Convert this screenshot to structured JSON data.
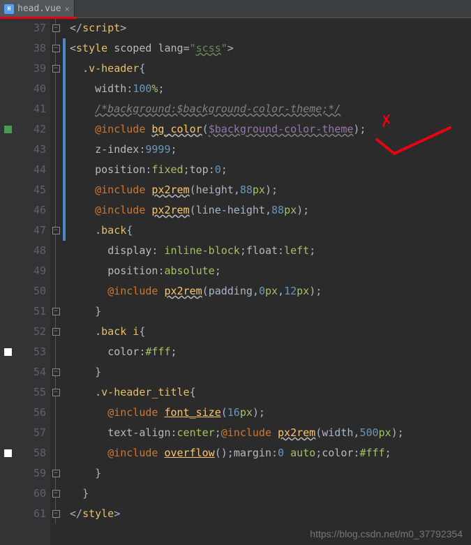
{
  "tab": {
    "icon_letter": "H",
    "filename": "head.vue",
    "close": "×"
  },
  "gutter": {
    "start": 37,
    "end": 61
  },
  "code_lines": [
    {
      "n": 37,
      "html": "<span class='punct'>&lt;/</span><span class='tag'>script</span><span class='punct'>&gt;</span>",
      "fold": "end"
    },
    {
      "n": 38,
      "html": "<span class='punct'>&lt;</span><span class='tag'>style </span><span class='attr'>scoped </span><span class='attr'>lang</span><span class='punct'>=</span><span class='str'>\"</span><span class='str-u'>scss</span><span class='str'>\"</span><span class='punct'>&gt;</span>",
      "fold": "start",
      "change": true
    },
    {
      "n": 39,
      "html": "  <span class='sel'>.v-header</span><span class='punct'>{</span>",
      "fold": "start",
      "change": true
    },
    {
      "n": 40,
      "html": "    <span class='prop'>width</span><span class='punct'>:</span><span class='num'>100</span><span class='val'>%</span><span class='punct'>;</span>",
      "change": true
    },
    {
      "n": 41,
      "html": "    <span class='comment'>/*background:$background-color-theme;*/</span>",
      "change": true
    },
    {
      "n": 42,
      "html": "    <span class='kw'>@include </span><span class='fn'>bg_color</span><span class='punct'>(</span><span class='var'>$background-color-theme</span><span class='punct'>);</span>",
      "mark": "green",
      "change": true
    },
    {
      "n": 43,
      "html": "    <span class='prop'>z-index</span><span class='punct'>:</span><span class='num'>9999</span><span class='punct'>;</span>",
      "change": true
    },
    {
      "n": 44,
      "html": "    <span class='prop'>position</span><span class='punct'>:</span><span class='val'>fixed</span><span class='punct'>;</span><span class='prop'>top</span><span class='punct'>:</span><span class='num'>0</span><span class='punct'>;</span>",
      "change": true
    },
    {
      "n": 45,
      "html": "    <span class='kw'>@include </span><span class='fn'>px2rem</span><span class='punct'>(</span><span class='ident'>height</span><span class='punct'>,</span><span class='num'>88</span><span class='val'>px</span><span class='punct'>);</span>",
      "change": true
    },
    {
      "n": 46,
      "html": "    <span class='kw'>@include </span><span class='fn'>px2rem</span><span class='punct'>(</span><span class='ident'>line-height</span><span class='punct'>,</span><span class='num'>88</span><span class='val'>px</span><span class='punct'>);</span>",
      "change": true
    },
    {
      "n": 47,
      "html": "    <span class='sel'>.back</span><span class='punct'>{</span>",
      "fold": "start",
      "change": true
    },
    {
      "n": 48,
      "html": "      <span class='prop'>display</span><span class='punct'>: </span><span class='val'>inline-block</span><span class='punct'>;</span><span class='prop'>float</span><span class='punct'>:</span><span class='val'>left</span><span class='punct'>;</span>"
    },
    {
      "n": 49,
      "html": "      <span class='prop'>position</span><span class='punct'>:</span><span class='val'>absolute</span><span class='punct'>;</span>"
    },
    {
      "n": 50,
      "html": "      <span class='kw'>@include </span><span class='fn'>px2rem</span><span class='punct'>(</span><span class='ident'>padding</span><span class='punct'>,</span><span class='num'>0</span><span class='val'>px</span><span class='punct'>,</span><span class='num'>12</span><span class='val'>px</span><span class='punct'>);</span>"
    },
    {
      "n": 51,
      "html": "    <span class='punct'>}</span>",
      "fold": "end"
    },
    {
      "n": 52,
      "html": "    <span class='sel'>.back i</span><span class='punct'>{</span>",
      "fold": "start"
    },
    {
      "n": 53,
      "html": "      <span class='prop'>color</span><span class='punct'>:</span><span class='hex'>#fff</span><span class='punct'>;</span>",
      "mark": "white"
    },
    {
      "n": 54,
      "html": "    <span class='punct'>}</span>",
      "fold": "end"
    },
    {
      "n": 55,
      "html": "    <span class='sel'>.v-header_title</span><span class='punct'>{</span>",
      "fold": "start"
    },
    {
      "n": 56,
      "html": "      <span class='kw'>@include </span><span class='fn2'>font_size</span><span class='punct'>(</span><span class='num'>16</span><span class='val'>px</span><span class='punct'>);</span>"
    },
    {
      "n": 57,
      "html": "      <span class='prop'>text-align</span><span class='punct'>:</span><span class='val'>center</span><span class='punct'>;</span><span class='kw'>@include </span><span class='fn'>px2rem</span><span class='punct'>(</span><span class='ident'>width</span><span class='punct'>,</span><span class='num'>500</span><span class='val'>px</span><span class='punct'>);</span>"
    },
    {
      "n": 58,
      "html": "      <span class='kw'>@include </span><span class='fn2'>overflow</span><span class='punct'>();</span><span class='prop'>margin</span><span class='punct'>:</span><span class='num'>0 </span><span class='val'>auto</span><span class='punct'>;</span><span class='prop'>color</span><span class='punct'>:</span><span class='hex'>#fff</span><span class='punct'>;</span>",
      "mark": "white"
    },
    {
      "n": 59,
      "html": "    <span class='punct'>}</span>",
      "fold": "end"
    },
    {
      "n": 60,
      "html": "  <span class='punct'>}</span>",
      "fold": "end"
    },
    {
      "n": 61,
      "html": "<span class='punct'>&lt;/</span><span class='tag'>style</span><span class='punct'>&gt;</span>",
      "fold": "end"
    }
  ],
  "watermark": "https://blog.csdn.net/m0_37792354"
}
